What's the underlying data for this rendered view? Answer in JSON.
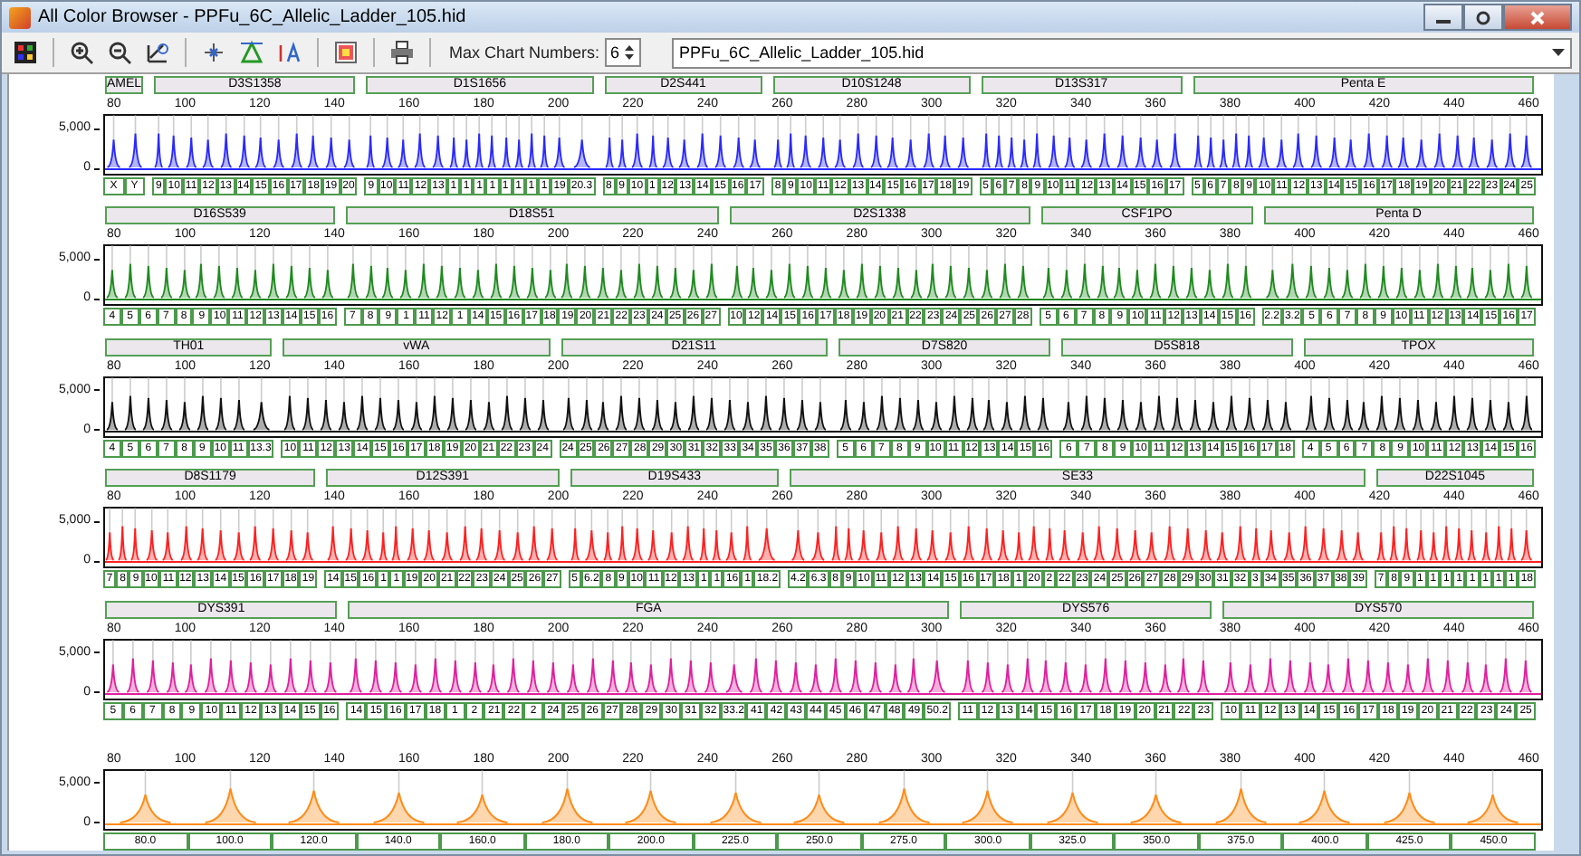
{
  "window": {
    "title": "All Color Browser - PPFu_6C_Allelic_Ladder_105.hid"
  },
  "toolbar": {
    "max_chart_label": "Max Chart Numbers:",
    "max_chart_value": "6",
    "file_select": "PPFu_6C_Allelic_Ladder_105.hid"
  },
  "panels": [
    {
      "color": "#2a2aff",
      "y_ticks": [
        "5,000",
        "0"
      ],
      "x_ticks": [
        "80",
        "100",
        "120",
        "140",
        "160",
        "180",
        "200",
        "220",
        "240",
        "260",
        "280",
        "300",
        "320",
        "340",
        "360",
        "380",
        "400",
        "420",
        "440",
        "460"
      ],
      "markers": [
        {
          "name": "AMEL",
          "alleles": [
            "X",
            "Y"
          ]
        },
        {
          "name": "D3S1358",
          "alleles": [
            "9",
            "10",
            "11",
            "12",
            "13",
            "14",
            "15",
            "16",
            "17",
            "18",
            "19",
            "20"
          ]
        },
        {
          "name": "D1S1656",
          "alleles": [
            "9",
            "10",
            "11",
            "12",
            "13",
            "1",
            "1",
            "1",
            "1",
            "1",
            "1",
            "1",
            "1",
            "19",
            "20.3"
          ]
        },
        {
          "name": "D2S441",
          "alleles": [
            "8",
            "9",
            "10",
            "1",
            "12",
            "13",
            "14",
            "15",
            "16",
            "17"
          ]
        },
        {
          "name": "D10S1248",
          "alleles": [
            "8",
            "9",
            "10",
            "11",
            "12",
            "13",
            "14",
            "15",
            "16",
            "17",
            "18",
            "19"
          ]
        },
        {
          "name": "D13S317",
          "alleles": [
            "5",
            "6",
            "7",
            "8",
            "9",
            "10",
            "11",
            "12",
            "13",
            "14",
            "15",
            "16",
            "17"
          ]
        },
        {
          "name": "Penta E",
          "alleles": [
            "5",
            "6",
            "7",
            "8",
            "9",
            "10",
            "11",
            "12",
            "13",
            "14",
            "15",
            "16",
            "17",
            "18",
            "19",
            "20",
            "21",
            "22",
            "23",
            "24",
            "25"
          ]
        }
      ]
    },
    {
      "color": "#1f8a1f",
      "y_ticks": [
        "5,000",
        "0"
      ],
      "x_ticks": [
        "80",
        "100",
        "120",
        "140",
        "160",
        "180",
        "200",
        "220",
        "240",
        "260",
        "280",
        "300",
        "320",
        "340",
        "360",
        "380",
        "400",
        "420",
        "440",
        "460"
      ],
      "markers": [
        {
          "name": "D16S539",
          "alleles": [
            "4",
            "5",
            "6",
            "7",
            "8",
            "9",
            "10",
            "11",
            "12",
            "13",
            "14",
            "15",
            "16"
          ]
        },
        {
          "name": "D18S51",
          "alleles": [
            "7",
            "8",
            "9",
            "1",
            "11",
            "12",
            "1",
            "14",
            "15",
            "16",
            "17",
            "18",
            "19",
            "20",
            "21",
            "22",
            "23",
            "24",
            "25",
            "26",
            "27"
          ]
        },
        {
          "name": "D2S1338",
          "alleles": [
            "10",
            "12",
            "14",
            "15",
            "16",
            "17",
            "18",
            "19",
            "20",
            "21",
            "22",
            "23",
            "24",
            "25",
            "26",
            "27",
            "28"
          ]
        },
        {
          "name": "CSF1PO",
          "alleles": [
            "5",
            "6",
            "7",
            "8",
            "9",
            "10",
            "11",
            "12",
            "13",
            "14",
            "15",
            "16"
          ]
        },
        {
          "name": "Penta D",
          "alleles": [
            "2.2",
            "3.2",
            "5",
            "6",
            "7",
            "8",
            "9",
            "10",
            "11",
            "12",
            "13",
            "14",
            "15",
            "16",
            "17"
          ]
        }
      ]
    },
    {
      "color": "#111111",
      "y_ticks": [
        "5,000",
        "0"
      ],
      "x_ticks": [
        "80",
        "100",
        "120",
        "140",
        "160",
        "180",
        "200",
        "220",
        "240",
        "260",
        "280",
        "300",
        "320",
        "340",
        "360",
        "380",
        "400",
        "420",
        "440",
        "460"
      ],
      "markers": [
        {
          "name": "TH01",
          "alleles": [
            "4",
            "5",
            "6",
            "7",
            "8",
            "9",
            "10",
            "11",
            "13.3"
          ]
        },
        {
          "name": "vWA",
          "alleles": [
            "10",
            "11",
            "12",
            "13",
            "14",
            "15",
            "16",
            "17",
            "18",
            "19",
            "20",
            "21",
            "22",
            "23",
            "24"
          ]
        },
        {
          "name": "D21S11",
          "alleles": [
            "24",
            "25",
            "26",
            "27",
            "28",
            "29",
            "30",
            "31",
            "32",
            "33",
            "34",
            "35",
            "36",
            "37",
            "38"
          ]
        },
        {
          "name": "D7S820",
          "alleles": [
            "5",
            "6",
            "7",
            "8",
            "9",
            "10",
            "11",
            "12",
            "13",
            "14",
            "15",
            "16"
          ]
        },
        {
          "name": "D5S818",
          "alleles": [
            "6",
            "7",
            "8",
            "9",
            "10",
            "11",
            "12",
            "13",
            "14",
            "15",
            "16",
            "17",
            "18"
          ]
        },
        {
          "name": "TPOX",
          "alleles": [
            "4",
            "5",
            "6",
            "7",
            "8",
            "9",
            "10",
            "11",
            "12",
            "13",
            "14",
            "15",
            "16"
          ]
        }
      ]
    },
    {
      "color": "#ff2020",
      "y_ticks": [
        "5,000",
        "0"
      ],
      "x_ticks": [
        "80",
        "100",
        "120",
        "140",
        "160",
        "180",
        "200",
        "220",
        "240",
        "260",
        "280",
        "300",
        "320",
        "340",
        "360",
        "380",
        "400",
        "420",
        "440",
        "460"
      ],
      "markers": [
        {
          "name": "D8S1179",
          "alleles": [
            "7",
            "8",
            "9",
            "10",
            "11",
            "12",
            "13",
            "14",
            "15",
            "16",
            "17",
            "18",
            "19"
          ]
        },
        {
          "name": "D12S391",
          "alleles": [
            "14",
            "15",
            "16",
            "1",
            "1",
            "19",
            "20",
            "21",
            "22",
            "23",
            "24",
            "25",
            "26",
            "27"
          ]
        },
        {
          "name": "D19S433",
          "alleles": [
            "5",
            "6.2",
            "8",
            "9",
            "10",
            "11",
            "12",
            "13",
            "1",
            "1",
            "16",
            "1",
            "18.2"
          ]
        },
        {
          "name": "SE33",
          "alleles": [
            "4.2",
            "6.3",
            "8",
            "9",
            "10",
            "11",
            "12",
            "13",
            "14",
            "15",
            "16",
            "17",
            "18",
            "1",
            "20",
            "2",
            "22",
            "23",
            "24",
            "25",
            "26",
            "27",
            "28",
            "29",
            "30",
            "31",
            "32",
            "3",
            "34",
            "35",
            "36",
            "37",
            "38",
            "39"
          ]
        },
        {
          "name": "D22S1045",
          "alleles": [
            "7",
            "8",
            "9",
            "1",
            "1",
            "1",
            "1",
            "1",
            "1",
            "1",
            "1",
            "18"
          ]
        }
      ]
    },
    {
      "color": "#e0209e",
      "y_ticks": [
        "5,000",
        "0"
      ],
      "x_ticks": [
        "80",
        "100",
        "120",
        "140",
        "160",
        "180",
        "200",
        "220",
        "240",
        "260",
        "280",
        "300",
        "320",
        "340",
        "360",
        "380",
        "400",
        "420",
        "440",
        "460"
      ],
      "markers": [
        {
          "name": "DYS391",
          "alleles": [
            "5",
            "6",
            "7",
            "8",
            "9",
            "10",
            "11",
            "12",
            "13",
            "14",
            "15",
            "16"
          ]
        },
        {
          "name": "FGA",
          "alleles": [
            "14",
            "15",
            "16",
            "17",
            "18",
            "1",
            "2",
            "21",
            "22",
            "2",
            "24",
            "25",
            "26",
            "27",
            "28",
            "29",
            "30",
            "31",
            "32",
            "33.2",
            "41",
            "42",
            "43",
            "44",
            "45",
            "46",
            "47",
            "48",
            "49",
            "50.2"
          ]
        },
        {
          "name": "DYS576",
          "alleles": [
            "11",
            "12",
            "13",
            "14",
            "15",
            "16",
            "17",
            "18",
            "19",
            "20",
            "21",
            "22",
            "23"
          ]
        },
        {
          "name": "DYS570",
          "alleles": [
            "10",
            "11",
            "12",
            "13",
            "14",
            "15",
            "16",
            "17",
            "18",
            "19",
            "20",
            "21",
            "22",
            "23",
            "24",
            "25"
          ]
        }
      ]
    },
    {
      "color": "#ff8c1a",
      "y_ticks": [
        "5,000",
        "0"
      ],
      "x_ticks": [
        "80",
        "100",
        "120",
        "140",
        "160",
        "180",
        "200",
        "220",
        "240",
        "260",
        "280",
        "300",
        "320",
        "340",
        "360",
        "380",
        "400",
        "420",
        "440",
        "460"
      ],
      "markers": [
        {
          "alleles": [
            "80.0",
            "100.0",
            "120.0",
            "140.0",
            "160.0",
            "180.0",
            "200.0",
            "225.0",
            "250.0",
            "275.0",
            "300.0",
            "325.0",
            "350.0",
            "375.0",
            "400.0",
            "425.0",
            "450.0"
          ]
        }
      ]
    }
  ]
}
